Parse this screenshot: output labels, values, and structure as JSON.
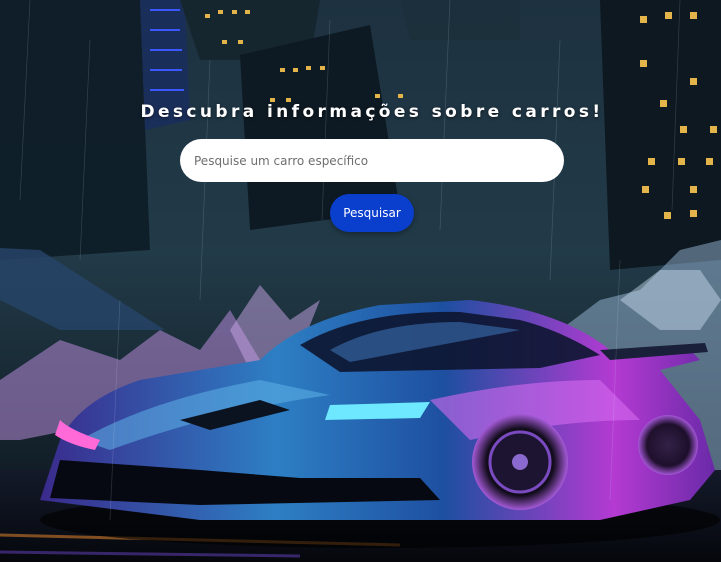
{
  "hero": {
    "title": "Descubra informações sobre carros!",
    "search": {
      "placeholder": "Pesquise um carro específico",
      "value": ""
    },
    "button_label": "Pesquisar"
  },
  "colors": {
    "button": "#0a3fce",
    "input_bg": "#ffffff",
    "title_text": "#ffffff"
  }
}
